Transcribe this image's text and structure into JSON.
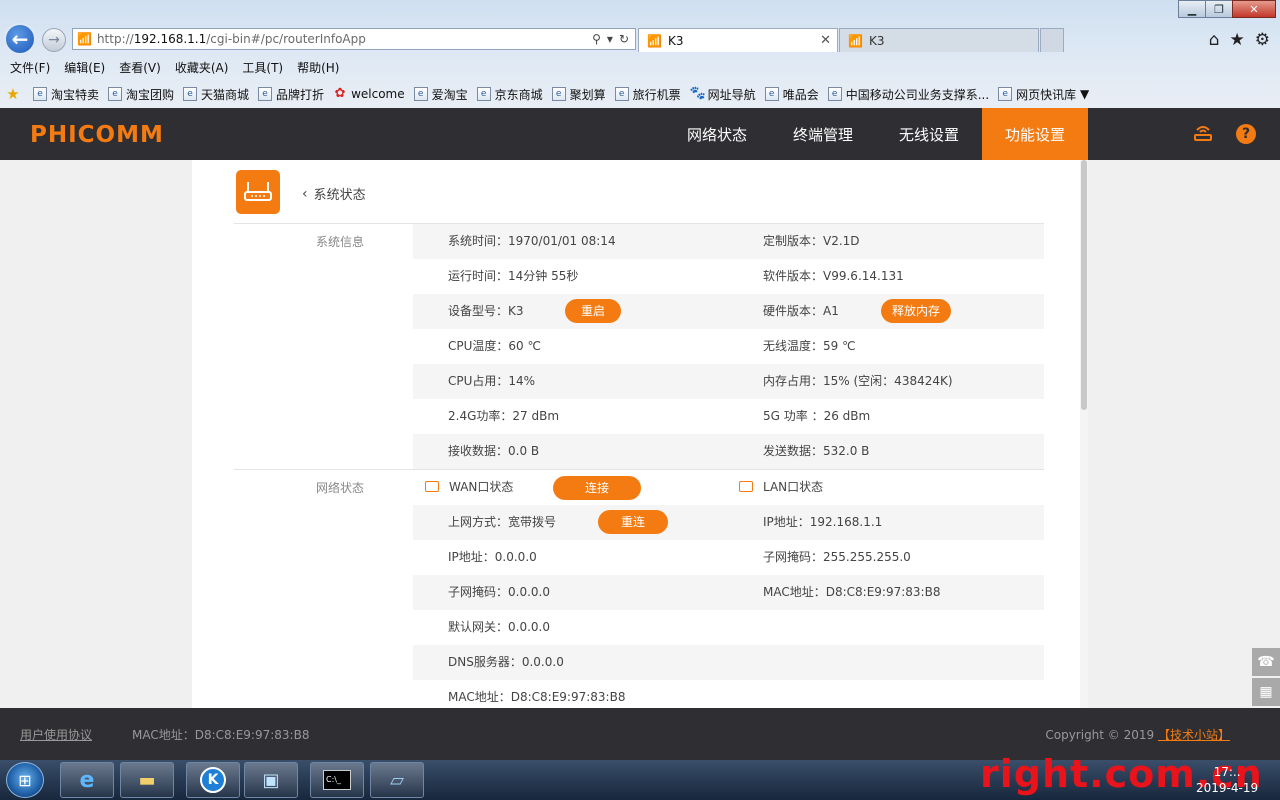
{
  "browser": {
    "address_prefix": "http://",
    "address_host": "192.168.1.1",
    "address_path": "/cgi-bin#/pc/routerInfoApp",
    "tabs": [
      {
        "title": "K3",
        "active": true
      },
      {
        "title": "K3",
        "active": false
      }
    ],
    "menu": [
      "文件(F)",
      "编辑(E)",
      "查看(V)",
      "收藏夹(A)",
      "工具(T)",
      "帮助(H)"
    ],
    "favorites": [
      "淘宝特卖",
      "淘宝团购",
      "天猫商城",
      "品牌打折",
      "welcome",
      "爱淘宝",
      "京东商城",
      "聚划算",
      "旅行机票",
      "网址导航",
      "唯品会",
      "中国移动公司业务支撑系...",
      "网页快讯库"
    ]
  },
  "app": {
    "logo": "PHICOMM",
    "nav": [
      "网络状态",
      "终端管理",
      "无线设置",
      "功能设置"
    ],
    "active_nav": "功能设置",
    "accent_color": "#f37b12",
    "header_bg": "#2e2e33"
  },
  "page": {
    "back_label": "系统状态",
    "system_section": "系统信息",
    "network_section": "网络状态",
    "system_rows": [
      {
        "l_label": "系统时间：",
        "l_value": "1970/01/01 08:14",
        "r_label": "定制版本：",
        "r_value": "V2.1D"
      },
      {
        "l_label": "运行时间：",
        "l_value": "14分钟 55秒",
        "r_label": "软件版本：",
        "r_value": "V99.6.14.131"
      },
      {
        "l_label": "设备型号：",
        "l_value": "K3",
        "r_label": "硬件版本：",
        "r_value": "A1"
      },
      {
        "l_label": "CPU温度：",
        "l_value": "60 ℃",
        "r_label": "无线温度：",
        "r_value": "59 ℃"
      },
      {
        "l_label": "CPU占用：",
        "l_value": "14%",
        "r_label": "内存占用：",
        "r_value": "15% (空闲：438424K)"
      },
      {
        "l_label": "2.4G功率：",
        "l_value": "27 dBm",
        "r_label": "5G 功率 ：",
        "r_value": "26 dBm"
      },
      {
        "l_label": "接收数据：",
        "l_value": "0.0 B",
        "r_label": "发送数据：",
        "r_value": "532.0 B"
      }
    ],
    "reboot_button": "重启",
    "free_memory_button": "释放内存",
    "wan_title": "WAN口状态",
    "lan_title": "LAN口状态",
    "connect_button": "连接",
    "reconnect_button": "重连",
    "wan_rows": [
      {
        "label": "上网方式：",
        "value": "宽带拨号"
      },
      {
        "label": "IP地址：",
        "value": "0.0.0.0"
      },
      {
        "label": "子网掩码：",
        "value": "0.0.0.0"
      },
      {
        "label": "默认网关：",
        "value": "0.0.0.0"
      },
      {
        "label": "DNS服务器：",
        "value": "0.0.0.0"
      },
      {
        "label": "MAC地址：",
        "value": "D8:C8:E9:97:83:B8"
      }
    ],
    "lan_rows": [
      {
        "label": "IP地址：",
        "value": "192.168.1.1"
      },
      {
        "label": "子网掩码：",
        "value": "255.255.255.0"
      },
      {
        "label": "MAC地址：",
        "value": "D8:C8:E9:97:83:B8"
      }
    ]
  },
  "footer": {
    "agreement": "用户使用协议",
    "mac": "MAC地址：D8:C8:E9:97:83:B8",
    "copyright": "Copyright © 2019 ",
    "forum": "【技术小站】"
  },
  "taskbar": {
    "watermark": "right.com.cn",
    "time": "17:..",
    "date": "2019-4-19"
  }
}
